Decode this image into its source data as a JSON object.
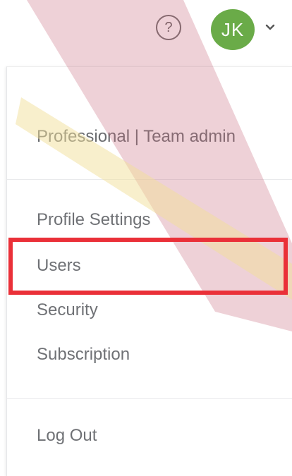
{
  "header": {
    "help_icon": "help-circle-icon",
    "help_glyph": "?",
    "avatar_initials": "JK",
    "avatar_color": "#6aab48",
    "chevron_icon": "chevron-down-icon"
  },
  "dropdown": {
    "plan_label": "Professional | Team admin",
    "menu_items": [
      {
        "label": "Profile Settings"
      },
      {
        "label": "Users",
        "highlighted": true
      },
      {
        "label": "Security"
      },
      {
        "label": "Subscription"
      }
    ],
    "logout_label": "Log Out"
  },
  "annotation": {
    "highlight_color": "#ea3038",
    "overlay_stripe_color": "#d9a3ad",
    "overlay_band_color": "#f3e6b3"
  }
}
